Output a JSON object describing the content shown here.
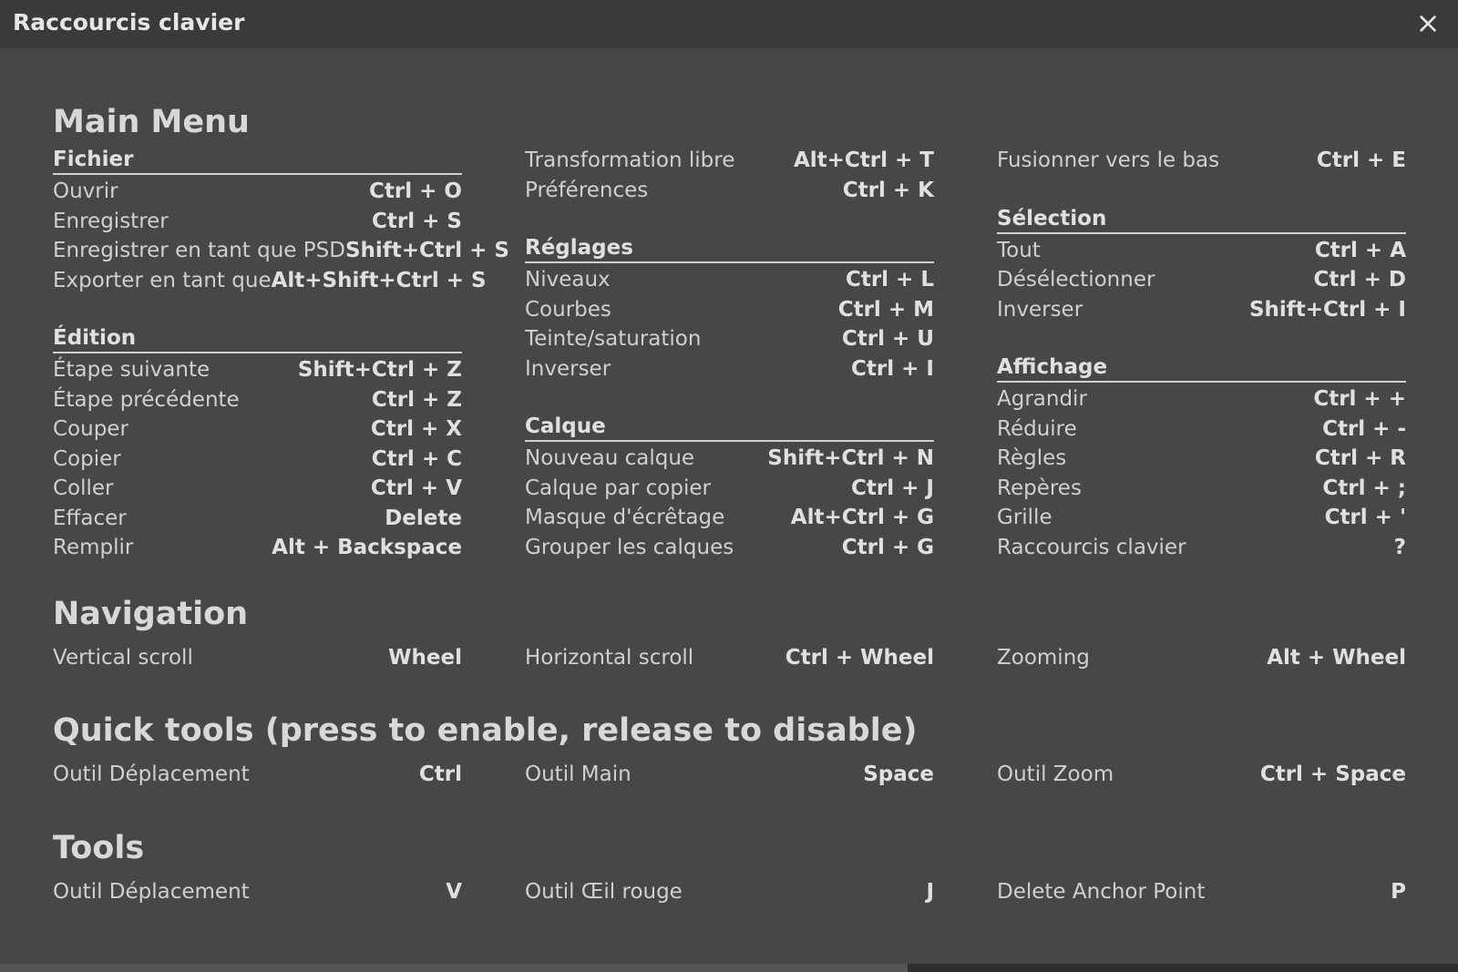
{
  "dialog": {
    "title": "Raccourcis clavier",
    "close_label": "×"
  },
  "sections": {
    "main_menu": {
      "title": "Main Menu",
      "fichier": {
        "title": "Fichier",
        "items": [
          {
            "label": "Ouvrir",
            "key": "Ctrl + O"
          },
          {
            "label": "Enregistrer",
            "key": "Ctrl + S"
          },
          {
            "label": "Enregistrer en tant que PSD",
            "key": "Shift+Ctrl + S"
          },
          {
            "label": "Exporter en tant que",
            "key": "Alt+Shift+Ctrl + S"
          }
        ]
      },
      "edition": {
        "title": "Édition",
        "items": [
          {
            "label": "Étape suivante",
            "key": "Shift+Ctrl + Z"
          },
          {
            "label": "Étape précédente",
            "key": "Ctrl + Z"
          },
          {
            "label": "Couper",
            "key": "Ctrl + X"
          },
          {
            "label": "Copier",
            "key": "Ctrl + C"
          },
          {
            "label": "Coller",
            "key": "Ctrl + V"
          },
          {
            "label": "Effacer",
            "key": "Delete"
          },
          {
            "label": "Remplir",
            "key": "Alt + Backspace"
          }
        ]
      },
      "misc": {
        "items": [
          {
            "label": "Transformation libre",
            "key": "Alt+Ctrl + T"
          },
          {
            "label": "Préférences",
            "key": "Ctrl + K"
          }
        ]
      },
      "reglages": {
        "title": "Réglages",
        "items": [
          {
            "label": "Niveaux",
            "key": "Ctrl + L"
          },
          {
            "label": "Courbes",
            "key": "Ctrl + M"
          },
          {
            "label": "Teinte/saturation",
            "key": "Ctrl + U"
          },
          {
            "label": "Inverser",
            "key": "Ctrl + I"
          }
        ]
      },
      "calque": {
        "title": "Calque",
        "items": [
          {
            "label": "Nouveau calque",
            "key": "Shift+Ctrl + N"
          },
          {
            "label": "Calque par copier",
            "key": "Ctrl + J"
          },
          {
            "label": "Masque d'écrêtage",
            "key": "Alt+Ctrl + G"
          },
          {
            "label": "Grouper les calques",
            "key": "Ctrl + G"
          }
        ]
      },
      "fusion": {
        "items": [
          {
            "label": "Fusionner vers le bas",
            "key": "Ctrl + E"
          }
        ]
      },
      "selection": {
        "title": "Sélection",
        "items": [
          {
            "label": "Tout",
            "key": "Ctrl + A"
          },
          {
            "label": "Désélectionner",
            "key": "Ctrl + D"
          },
          {
            "label": "Inverser",
            "key": "Shift+Ctrl + I"
          }
        ]
      },
      "affichage": {
        "title": "Affichage",
        "items": [
          {
            "label": "Agrandir",
            "key": "Ctrl + +"
          },
          {
            "label": "Réduire",
            "key": "Ctrl + -"
          },
          {
            "label": "Règles",
            "key": "Ctrl + R"
          },
          {
            "label": "Repères",
            "key": "Ctrl + ;"
          },
          {
            "label": "Grille",
            "key": "Ctrl + '"
          },
          {
            "label": "Raccourcis clavier",
            "key": "?"
          }
        ]
      }
    },
    "navigation": {
      "title": "Navigation",
      "items": [
        {
          "label": "Vertical scroll",
          "key": "Wheel"
        },
        {
          "label": "Horizontal scroll",
          "key": "Ctrl + Wheel"
        },
        {
          "label": "Zooming",
          "key": "Alt + Wheel"
        }
      ]
    },
    "quick_tools": {
      "title": "Quick tools (press to enable, release to disable)",
      "items": [
        {
          "label": "Outil Déplacement",
          "key": "Ctrl"
        },
        {
          "label": "Outil Main",
          "key": "Space"
        },
        {
          "label": "Outil Zoom",
          "key": "Ctrl + Space"
        }
      ]
    },
    "tools": {
      "title": "Tools",
      "items": [
        {
          "label": "Outil Déplacement",
          "key": "V"
        },
        {
          "label": "Outil Œil rouge",
          "key": "J"
        },
        {
          "label": "Delete Anchor Point",
          "key": "P"
        }
      ]
    }
  }
}
